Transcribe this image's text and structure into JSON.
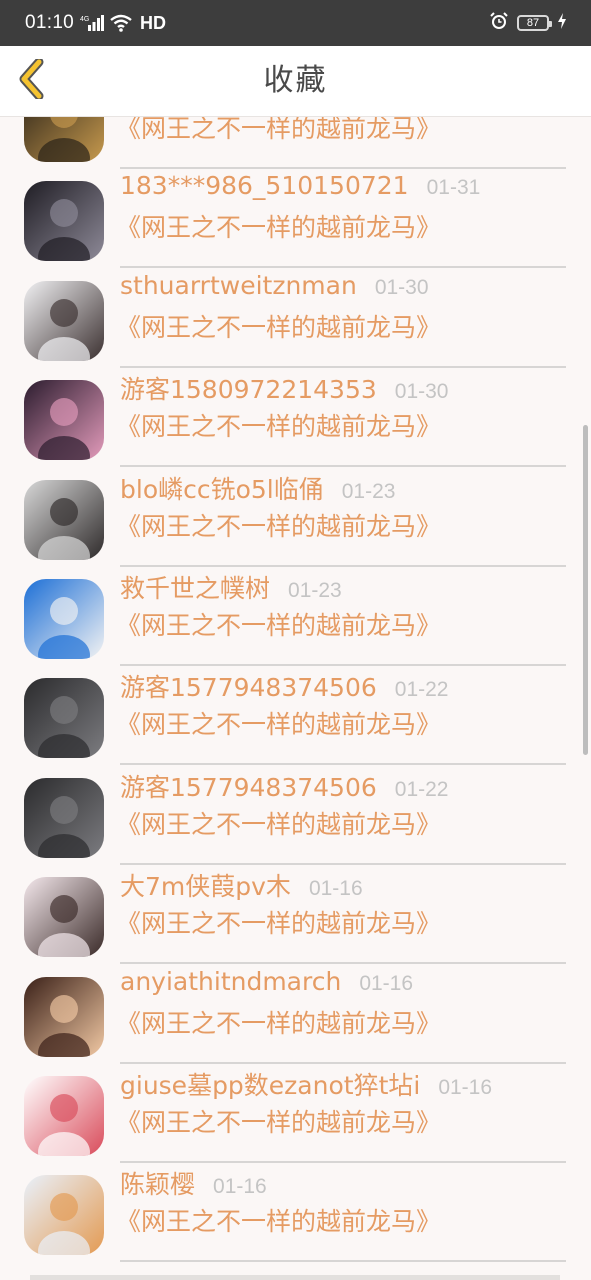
{
  "status_bar": {
    "time": "01:10",
    "network_tag": "4G",
    "hd": "HD",
    "battery": "87",
    "icons": [
      "signal-icon",
      "wifi-icon",
      "alarm-icon",
      "battery-icon",
      "charging-icon"
    ]
  },
  "header": {
    "title": "收藏",
    "back_icon": "chevron-left-icon"
  },
  "colors": {
    "accent": "#e59b63",
    "date": "#c4c4c4",
    "title_text": "#4a4a4a",
    "back_icon_stroke": "#555555",
    "back_icon_fill": "#f5c330",
    "background": "#fbf7f6",
    "status_bar": "#3d3d3d"
  },
  "favorites": [
    {
      "user": "",
      "date": "",
      "title": "《网王之不一样的越前龙马》",
      "avatar_colors": [
        "#2a2218",
        "#c79a4e"
      ]
    },
    {
      "user": "183***986_510150721",
      "date": "01-31",
      "title": "《网王之不一样的越前龙马》",
      "avatar_colors": [
        "#1f1d24",
        "#8e8a98"
      ]
    },
    {
      "user": "sthuarrtweitznman",
      "date": "01-30",
      "title": "《网王之不一样的越前龙马》",
      "avatar_colors": [
        "#f1f1f3",
        "#3b3030"
      ]
    },
    {
      "user": "游客1580972214353",
      "date": "01-30",
      "title": "《网王之不一样的越前龙马》",
      "avatar_colors": [
        "#2b1c2e",
        "#e39bbb"
      ]
    },
    {
      "user": "blo嶙cc铣o5l临俑",
      "date": "01-23",
      "title": "《网王之不一样的越前龙马》",
      "avatar_colors": [
        "#d8d8d8",
        "#2e2a2a"
      ]
    },
    {
      "user": "救千世之幞树",
      "date": "01-23",
      "title": "《网王之不一样的越前龙马》",
      "avatar_colors": [
        "#1d6fd6",
        "#f3f3f3"
      ]
    },
    {
      "user": "游客1577948374506",
      "date": "01-22",
      "title": "《网王之不一样的越前龙马》",
      "avatar_colors": [
        "#2b2b2d",
        "#7c7c80"
      ]
    },
    {
      "user": "游客1577948374506",
      "date": "01-22",
      "title": "《网王之不一样的越前龙马》",
      "avatar_colors": [
        "#2b2b2d",
        "#7c7c80"
      ]
    },
    {
      "user": "大7m侠葭pv木",
      "date": "01-16",
      "title": "《网王之不一样的越前龙马》",
      "avatar_colors": [
        "#f4e8ec",
        "#3a2a28"
      ]
    },
    {
      "user": "anyiathitndmarch",
      "date": "01-16",
      "title": "《网王之不一样的越前龙马》",
      "avatar_colors": [
        "#3a2018",
        "#f2c9a4"
      ]
    },
    {
      "user": "giuse墓pp数ezanot猝t坫i",
      "date": "01-16",
      "title": "《网王之不一样的越前龙马》",
      "avatar_colors": [
        "#ffffff",
        "#d94b5a"
      ]
    },
    {
      "user": "陈颖樱",
      "date": "01-16",
      "title": "《网王之不一样的越前龙马》",
      "avatar_colors": [
        "#e9f1fb",
        "#e39a52"
      ]
    }
  ]
}
